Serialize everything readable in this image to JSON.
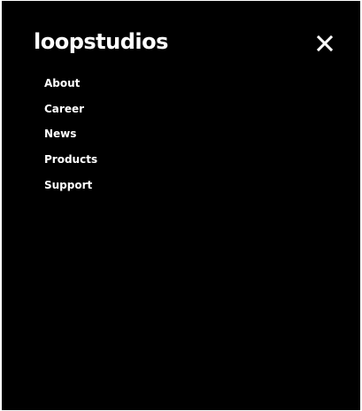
{
  "brand": {
    "logo_text": "loopstudios"
  },
  "header": {
    "close_icon": "close-icon"
  },
  "menu": {
    "items": [
      {
        "label": "About"
      },
      {
        "label": "Career"
      },
      {
        "label": "News"
      },
      {
        "label": "Products"
      },
      {
        "label": "Support"
      }
    ]
  },
  "colors": {
    "background": "#000000",
    "text": "#ffffff"
  }
}
